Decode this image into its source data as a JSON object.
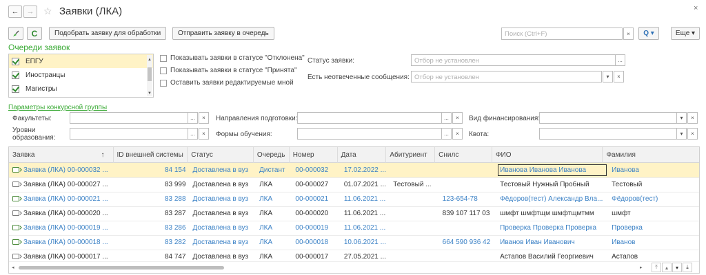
{
  "window": {
    "title": "Заявки (ЛКА)",
    "close": "×"
  },
  "toolbar": {
    "pick_label": "Подобрать заявку для обработки",
    "send_label": "Отправить заявку в очередь",
    "search_placeholder": "Поиск (Ctrl+F)",
    "search_clear": "×",
    "search_btn": "Q ▾",
    "more_label": "Еще ▾"
  },
  "queues": {
    "title": "Очереди заявок",
    "items": [
      "ЕПГУ",
      "Иностранцы",
      "Магистры"
    ]
  },
  "options": {
    "show_rejected": "Показывать заявки в статусе \"Отклонена\"",
    "show_accepted": "Показывать заявки в статусе \"Принята\"",
    "leave_mine": "Оставить заявки редактируемые мной"
  },
  "status_filter": {
    "label": "Статус заявки:",
    "placeholder": "Отбор не установлен"
  },
  "messages_filter": {
    "label": "Есть неотвеченные сообщения:",
    "placeholder": "Отбор не установлен"
  },
  "competitive": {
    "link": "Параметры конкурсной группы",
    "faculties": "Факультеты:",
    "levels_1": "Уровни",
    "levels_2": "образования:",
    "directions": "Направления подготовки:",
    "forms": "Формы обучения:",
    "financing": "Вид финансирования:",
    "quota": "Квота:"
  },
  "table": {
    "headers": [
      "Заявка",
      "ID внешней системы",
      "Статус",
      "Очередь",
      "Номер",
      "Дата",
      "Абитуриент",
      "Снилс",
      "ФИО",
      "Фамилия"
    ],
    "sort_mark": "↑",
    "rows": [
      {
        "zayavka": "Заявка (ЛКА) 00-000032 ...",
        "id": "84 154",
        "status": "Доставлена в вуз",
        "queue": "Дистант",
        "num": "00-000032",
        "date": "17.02.2022 ...",
        "abit": "",
        "snils": "",
        "fio": "Иванова Иванова Иванова",
        "fam": "Иванова"
      },
      {
        "zayavka": "Заявка (ЛКА) 00-000027 ...",
        "id": "83 999",
        "status": "Доставлена в вуз",
        "queue": "ЛКА",
        "num": "00-000027",
        "date": "01.07.2021 ...",
        "abit": "Тестовый ...",
        "snils": "",
        "fio": "Тестовый Нужный Пробный",
        "fam": "Тестовый"
      },
      {
        "zayavka": "Заявка (ЛКА) 00-000021 ...",
        "id": "83 288",
        "status": "Доставлена в вуз",
        "queue": "ЛКА",
        "num": "00-000021",
        "date": "11.06.2021 ...",
        "abit": "",
        "snils": "123-654-78",
        "fio": "Фёдоров(тест) Александр Вла...",
        "fam": "Фёдоров(тест)"
      },
      {
        "zayavka": "Заявка (ЛКА) 00-000020 ...",
        "id": "83 287",
        "status": "Доставлена в вуз",
        "queue": "ЛКА",
        "num": "00-000020",
        "date": "11.06.2021 ...",
        "abit": "",
        "snils": "839 107 117 03",
        "fio": "шмфт шмфтщм шмфтщмтмм",
        "fam": "шмфт"
      },
      {
        "zayavka": "Заявка (ЛКА) 00-000019 ...",
        "id": "83 286",
        "status": "Доставлена в вуз",
        "queue": "ЛКА",
        "num": "00-000019",
        "date": "11.06.2021 ...",
        "abit": "",
        "snils": "",
        "fio": "Проверка Проверка Проверка",
        "fam": "Проверка"
      },
      {
        "zayavka": "Заявка (ЛКА) 00-000018 ...",
        "id": "83 282",
        "status": "Доставлена в вуз",
        "queue": "ЛКА",
        "num": "00-000018",
        "date": "10.06.2021 ...",
        "abit": "",
        "snils": "664 590 936 42",
        "fio": "Иванов Иван Иванович",
        "fam": "Иванов"
      },
      {
        "zayavka": "Заявка (ЛКА) 00-000017 ...",
        "id": "84 747",
        "status": "Доставлена в вуз",
        "queue": "ЛКА",
        "num": "00-000017",
        "date": "27.05.2021 ...",
        "abit": "",
        "snils": "",
        "fio": "Астапов Василий Георгиевич",
        "fam": "Астапов"
      }
    ]
  },
  "colors": {
    "accent_green": "#3aaa35",
    "link_blue": "#3c82c6",
    "selected_row": "#fff3c6"
  }
}
